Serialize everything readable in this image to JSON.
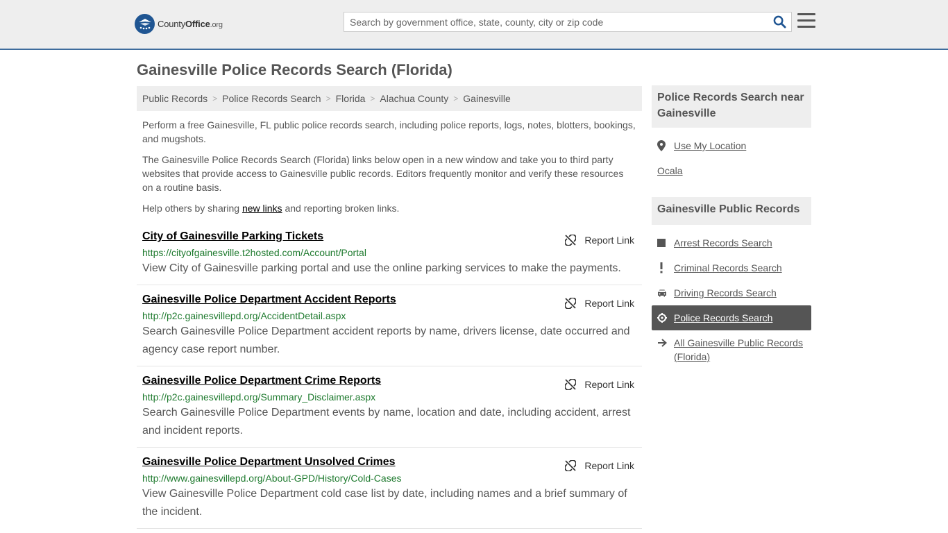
{
  "header": {
    "logo_brand": "County",
    "logo_brand2": "Office",
    "logo_tld": ".org",
    "search_placeholder": "Search by government office, state, county, city or zip code"
  },
  "page_title": "Gainesville Police Records Search (Florida)",
  "breadcrumb": [
    "Public Records",
    "Police Records Search",
    "Florida",
    "Alachua County",
    "Gainesville"
  ],
  "intro": {
    "p1": "Perform a free Gainesville, FL public police records search, including police reports, logs, notes, blotters, bookings, and mugshots.",
    "p2": "The Gainesville Police Records Search (Florida) links below open in a new window and take you to third party websites that provide access to Gainesville public records. Editors frequently monitor and verify these resources on a routine basis.",
    "p3_before": "Help others by sharing ",
    "p3_link": "new links",
    "p3_after": " and reporting broken links."
  },
  "report_link_label": "Report Link",
  "listings": [
    {
      "title": "City of Gainesville Parking Tickets",
      "url": "https://cityofgainesville.t2hosted.com/Account/Portal",
      "desc": "View City of Gainesville parking portal and use the online parking services to make the payments."
    },
    {
      "title": "Gainesville Police Department Accident Reports",
      "url": "http://p2c.gainesvillepd.org/AccidentDetail.aspx",
      "desc": "Search Gainesville Police Department accident reports by name, drivers license, date occurred and agency case report number."
    },
    {
      "title": "Gainesville Police Department Crime Reports",
      "url": "http://p2c.gainesvillepd.org/Summary_Disclaimer.aspx",
      "desc": "Search Gainesville Police Department events by name, location and date, including accident, arrest and incident reports."
    },
    {
      "title": "Gainesville Police Department Unsolved Crimes",
      "url": "http://www.gainesvillepd.org/About-GPD/History/Cold-Cases",
      "desc": "View Gainesville Police Department cold case list by date, including names and a brief summary of the incident."
    }
  ],
  "sidebar": {
    "near_heading": "Police Records Search near Gainesville",
    "use_location": "Use My Location",
    "nearby_city": "Ocala",
    "records_heading": "Gainesville Public Records",
    "records_items": [
      {
        "label": "Arrest Records Search",
        "icon": "square-icon"
      },
      {
        "label": "Criminal Records Search",
        "icon": "exclamation-icon"
      },
      {
        "label": "Driving Records Search",
        "icon": "car-icon"
      },
      {
        "label": "Police Records Search",
        "icon": "crosshair-icon"
      },
      {
        "label": "All Gainesville Public Records (Florida)",
        "icon": "arrow-right-icon"
      }
    ]
  },
  "colors": {
    "header_bg": "#eeeeee",
    "header_border": "#3e6c9c",
    "search_icon": "#1f5592",
    "url_green": "#1e7a2e",
    "active_bg": "#555555"
  }
}
